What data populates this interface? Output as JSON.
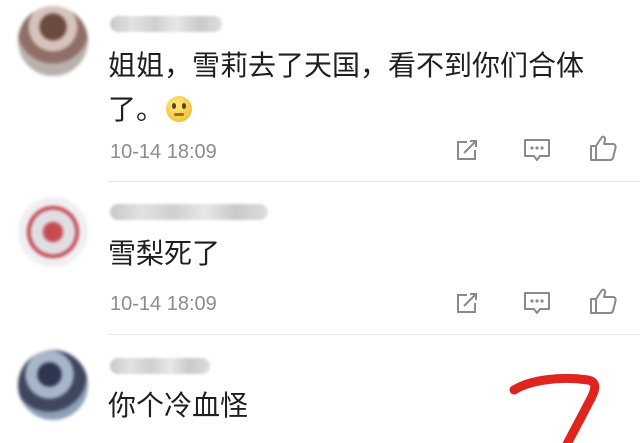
{
  "comments": [
    {
      "text_line1": "姐姐，雪莉去了天国，看不到你们合体",
      "text_line2": "了。",
      "emoji": "pleading-face-emoji",
      "timestamp": "10-14 18:09"
    },
    {
      "text": "雪梨死了",
      "timestamp": "10-14 18:09"
    },
    {
      "text": "你个冷血怪"
    }
  ],
  "icons": {
    "share": "share-icon",
    "reply": "reply-icon",
    "like": "like-icon"
  },
  "colors": {
    "text": "#1f1f1f",
    "meta": "#8c8c8c",
    "icon": "#8a8a8a",
    "annotation": "#e0241e"
  }
}
